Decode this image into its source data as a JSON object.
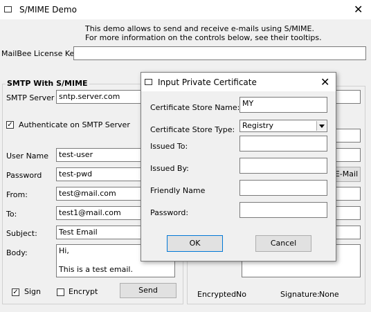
{
  "window": {
    "title": "S/MIME Demo",
    "close_symbol": "✕"
  },
  "intro": {
    "line1": "This demo allows to send and receive e-mails using S/MIME.",
    "line2": "For more information on the controls below, see their tooltips."
  },
  "license": {
    "label": "MailBee License Key",
    "value": ""
  },
  "smtp": {
    "group_title": "SMTP With S/MIME",
    "server_label": "SMTP Server",
    "server_value": "sntp.server.com",
    "auth_label": "Authenticate on SMTP Server",
    "auth_checked": "✓",
    "username_label": "User Name",
    "username_value": "test-user",
    "password_label": "Password",
    "password_value": "test-pwd",
    "from_label": "From:",
    "from_value": "test@mail.com",
    "to_label": "To:",
    "to_value": "test1@mail.com",
    "subject_label": "Subject:",
    "subject_value": "Test Email",
    "body_label": "Body:",
    "body_line1": "Hi,",
    "body_line2": "This is a test email.",
    "sign_label": "Sign",
    "sign_checked": "✓",
    "encrypt_label": "Encrypt",
    "send_label": "Send"
  },
  "receive": {
    "email_button_label": "E-Mail",
    "encrypted_label": "Encrypted:",
    "encrypted_value": "No",
    "signature_label": "Signature:",
    "signature_value": "None"
  },
  "dialog": {
    "title": "Input Private Certificate",
    "close_symbol": "✕",
    "store_name_label": "Certificate Store Name:",
    "store_name_value": "MY",
    "store_type_label": "Certificate Store Type:",
    "store_type_value": "Registry",
    "issued_to_label": "Issued To:",
    "issued_to_value": "",
    "issued_by_label": "Issued By:",
    "issued_by_value": "",
    "friendly_label": "Friendly Name",
    "friendly_value": "",
    "password_label": "Password:",
    "password_value": "",
    "ok_label": "OK",
    "cancel_label": "Cancel"
  }
}
